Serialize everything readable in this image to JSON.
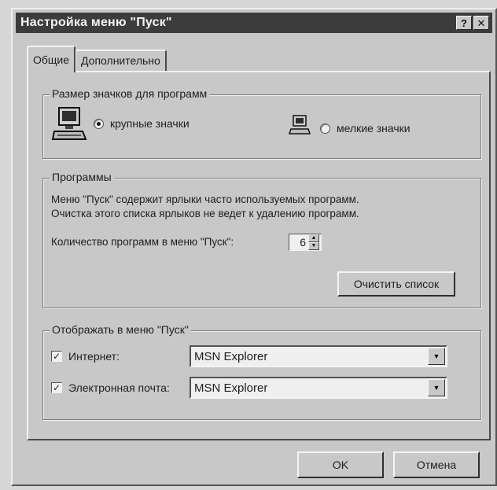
{
  "window": {
    "title": "Настройка меню \"Пуск\"",
    "help_button": "?",
    "close_button": "✕"
  },
  "tabs": [
    {
      "label": "Общие",
      "active": true
    },
    {
      "label": "Дополнительно",
      "active": false
    }
  ],
  "icon_size": {
    "legend": "Размер значков для программ",
    "large_label": "крупные значки",
    "small_label": "мелкие значки",
    "selected": "large"
  },
  "programs": {
    "legend": "Программы",
    "description_line1": "Меню \"Пуск\" содержит ярлыки часто используемых программ.",
    "description_line2": "Очистка этого списка ярлыков не ведет к удалению программ.",
    "count_label": "Количество программ в меню \"Пуск\":",
    "count_value": "6",
    "clear_button": "Очистить список"
  },
  "show_in_menu": {
    "legend": "Отображать в меню \"Пуск\"",
    "internet_label": "Интернет:",
    "internet_checked": true,
    "internet_value": "MSN Explorer",
    "email_label": "Электронная почта:",
    "email_checked": true,
    "email_value": "MSN Explorer"
  },
  "footer": {
    "ok_label": "OK",
    "cancel_label": "Отмена"
  }
}
